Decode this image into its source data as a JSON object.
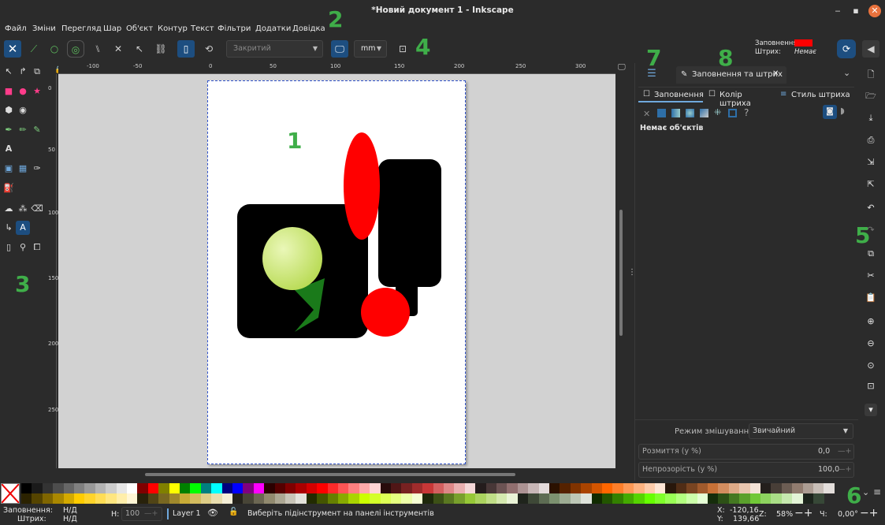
{
  "window": {
    "title": "*Новий документ 1 - Inkscape",
    "minimize": "‒",
    "maximize": "▪",
    "close": "✕"
  },
  "menu": [
    "Файл",
    "Зміни",
    "Перегляд",
    "Шар",
    "Об'єкт",
    "Контур",
    "Текст",
    "Фільтри",
    "Додатки",
    "Довідка"
  ],
  "controls": {
    "shape_combo": "Закритий",
    "unit_combo": "mm",
    "fill_label": "Заповнення:",
    "stroke_label": "Штрих:",
    "stroke_value": "Немає",
    "fill_color": "#ff0000"
  },
  "ruler_top": [
    "-100",
    "-50",
    "0",
    "50",
    "100",
    "150",
    "200",
    "250",
    "300"
  ],
  "ruler_left": [
    "0",
    "50",
    "100",
    "150",
    "200",
    "250"
  ],
  "dock": {
    "tab_title": "Заповнення та штрих",
    "subtabs": [
      "Заповнення",
      "Колір штриха",
      "Стиль штриха"
    ],
    "no_objects": "Немає об'єктів",
    "blend_label": "Режим змішування:",
    "blend_value": "Звичайний",
    "blur_label": "Розмиття (у %)",
    "blur_value": "0,0",
    "opacity_label": "Непрозорість (у %)",
    "opacity_value": "100,0"
  },
  "annotations": [
    "1",
    "2",
    "3",
    "4",
    "5",
    "6",
    "7",
    "8"
  ],
  "status": {
    "fill_label": "Заповнення:",
    "fill_value": "Н/Д",
    "stroke_label": "Штрих:",
    "stroke_value": "Н/Д",
    "h_label": "Н:",
    "h_value": "100",
    "layer": "Layer 1",
    "message": "Виберіть підінструмент на панелі інструментів",
    "x_label": "X:",
    "x_value": "-120,16",
    "y_label": "Y:",
    "y_value": "139,66",
    "z_label": "Z:",
    "zoom": "58%",
    "rot_label": "Ч:",
    "rotation": "0,00°"
  },
  "palette_row1": [
    "#000000",
    "#1a1a1a",
    "#333333",
    "#4d4d4d",
    "#666666",
    "#808080",
    "#999999",
    "#b3b3b3",
    "#cccccc",
    "#e6e6e6",
    "#ffffff",
    "#800000",
    "#ff0000",
    "#808000",
    "#ffff00",
    "#008000",
    "#00ff00",
    "#008080",
    "#00ffff",
    "#000080",
    "#0000ff",
    "#800080",
    "#ff00ff",
    "#2b0000",
    "#550000",
    "#800000",
    "#aa0000",
    "#d40000",
    "#ff0000",
    "#ff2a2a",
    "#ff5555",
    "#ff8080",
    "#ffaaaa",
    "#ffd5d5",
    "#280b0b",
    "#501616",
    "#782121",
    "#a02c2c",
    "#c83737",
    "#d35f5f",
    "#de8787",
    "#e9afaf",
    "#f4d7d7",
    "#241c1c",
    "#483737",
    "#6c5353",
    "#916f6f",
    "#ac9393",
    "#c8b7b7",
    "#e3dbdb",
    "#2b1100",
    "#552200",
    "#803300",
    "#aa4400",
    "#d45500",
    "#ff6600",
    "#ff7f2a",
    "#ff9955",
    "#ffb380",
    "#ffccaa",
    "#ffe6d5",
    "#28170b",
    "#502d16",
    "#784421",
    "#a05a2c",
    "#c87137",
    "#d38d5f",
    "#deaa87",
    "#e9c6af",
    "#f4e3d7",
    "#241f1c",
    "#483e37",
    "#6c5d53",
    "#917c6f",
    "#ac9d93",
    "#c8beb7",
    "#e3dedb"
  ],
  "palette_row2": [
    "#2b2200",
    "#554400",
    "#806600",
    "#aa8800",
    "#d4aa00",
    "#ffcc00",
    "#ffd42a",
    "#ffdd55",
    "#ffe680",
    "#ffeeaa",
    "#fff6d5",
    "#28220b",
    "#504416",
    "#786721",
    "#a0892c",
    "#c8ab37",
    "#d3bc5f",
    "#decd87",
    "#e9ddaf",
    "#f4eed7",
    "#24221c",
    "#484537",
    "#6c6753",
    "#918a6f",
    "#aca793",
    "#c8c4b7",
    "#e3e2db",
    "#222b00",
    "#445500",
    "#668000",
    "#88aa00",
    "#aad400",
    "#ccff00",
    "#d4ff2a",
    "#ddff55",
    "#e5ff80",
    "#eeffaa",
    "#f6ffd5",
    "#1e280b",
    "#3c5016",
    "#5a7821",
    "#78a02c",
    "#96c837",
    "#abd35f",
    "#c0de87",
    "#d5e9af",
    "#eaf4d7",
    "#1f241c",
    "#3e4837",
    "#5d6c53",
    "#7c916f",
    "#9dac93",
    "#bec8b7",
    "#dee3db",
    "#112b00",
    "#225500",
    "#338000",
    "#44aa00",
    "#55d400",
    "#66ff00",
    "#7fff2a",
    "#99ff55",
    "#b3ff80",
    "#ccffaa",
    "#e5ffd5",
    "#162d0b",
    "#2d5016",
    "#447821",
    "#5aa02c",
    "#71c837",
    "#8dd35f",
    "#aade87",
    "#c6e9af",
    "#e3f4d7",
    "#1c241c",
    "#374837"
  ]
}
